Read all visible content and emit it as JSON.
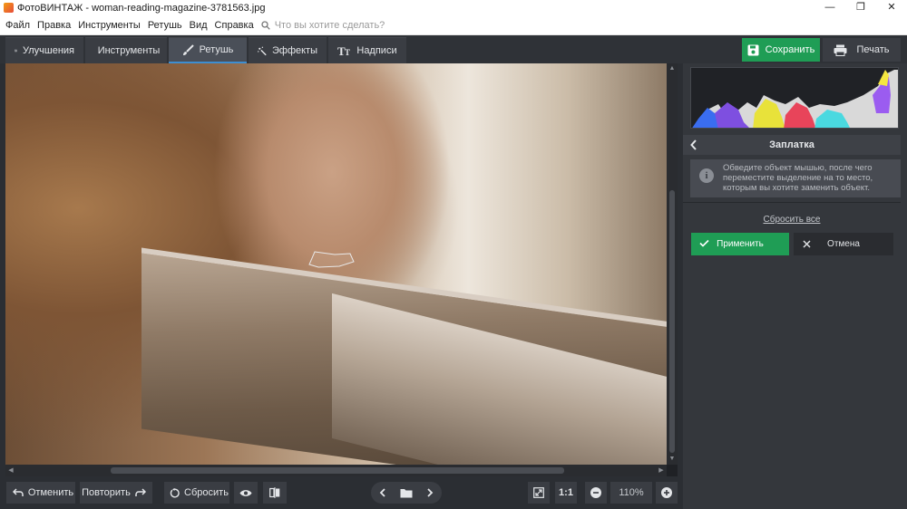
{
  "window": {
    "title": "ФотоВИНТАЖ - woman-reading-magazine-3781563.jpg",
    "controls": [
      "—",
      "❐",
      "✕"
    ]
  },
  "menu": {
    "items": [
      "Файл",
      "Правка",
      "Инструменты",
      "Ретушь",
      "Вид",
      "Справка"
    ],
    "search_placeholder": "Что вы хотите сделать?"
  },
  "tabs": [
    {
      "label": "Улучшения",
      "icon": "sliders-icon",
      "active": false
    },
    {
      "label": "Инструменты",
      "icon": "crop-icon",
      "active": false
    },
    {
      "label": "Ретушь",
      "icon": "brush-icon",
      "active": true
    },
    {
      "label": "Эффекты",
      "icon": "magic-wand-icon",
      "active": false
    },
    {
      "label": "Надписи",
      "icon": "text-icon",
      "active": false
    }
  ],
  "actions": {
    "save_label": "Сохранить",
    "print_label": "Печать"
  },
  "bottom": {
    "undo_label": "Отменить",
    "redo_label": "Повторить",
    "reset_label": "Сбросить",
    "fit_label": "1:1",
    "zoom": "110%"
  },
  "panel": {
    "title": "Заплатка",
    "info": "Обведите объект мышью, после чего переместите выделение на то место, которым вы хотите заменить объект.",
    "reset_all_label": "Сбросить все",
    "apply_label": "Применить",
    "cancel_label": "Отмена"
  },
  "colors": {
    "accent_green": "#1f9d55",
    "active_tab_blue": "#3d8ed1",
    "background": "#2b2e33"
  }
}
